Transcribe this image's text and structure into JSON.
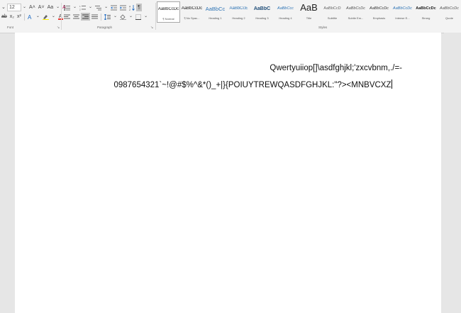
{
  "ribbon": {
    "font": {
      "size": "12",
      "grow": "A˄",
      "shrink": "A˅",
      "case": "Aa",
      "clear": "A",
      "superscript": "x²",
      "subscript": "x₂",
      "highlight": "A",
      "color": "A",
      "label": "Font"
    },
    "paragraph": {
      "pilcrow": "¶",
      "label": "Paragraph"
    },
    "styles": {
      "label": "Styles",
      "items": [
        {
          "preview": "AaBbCcDc",
          "name": "¶ Normal"
        },
        {
          "preview": "AaBbCcDc",
          "name": "¶ No Spac..."
        },
        {
          "preview": "AaBbCc",
          "name": "Heading 1"
        },
        {
          "preview": "AaBbCcE",
          "name": "Heading 2"
        },
        {
          "preview": "AaBbC",
          "name": "Heading 3"
        },
        {
          "preview": "AaBbCcc",
          "name": "Heading 4"
        },
        {
          "preview": "AaB",
          "name": "Title"
        },
        {
          "preview": "AaBbCcD",
          "name": "Subtitle"
        },
        {
          "preview": "AaBbCcDc",
          "name": "Subtle Em..."
        },
        {
          "preview": "AaBbCcDc",
          "name": "Emphasis"
        },
        {
          "preview": "AaBbCcDc",
          "name": "Intense E..."
        },
        {
          "preview": "AaBbCcDc",
          "name": "Strong"
        },
        {
          "preview": "AaBbCcDc",
          "name": "Quote"
        }
      ]
    }
  },
  "document": {
    "line1": "Qwertyuiiop[]\\asdfghjkl;'zxcvbnm,./=-",
    "line2": "0987654321`~!@#$%^&*()_+|}{POIUYTREWQASDFGHJKL:\"?><MNBVCXZ"
  }
}
